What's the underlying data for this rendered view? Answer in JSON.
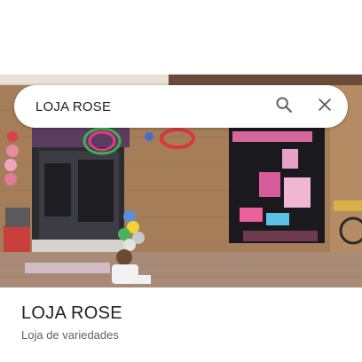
{
  "search": {
    "query": "LOJA ROSE",
    "search_icon": "search-icon",
    "close_icon": "close-icon"
  },
  "photo": {
    "kind": "street-view-storefront"
  },
  "place": {
    "name": "LOJA ROSE",
    "category": "Loja de variedades"
  },
  "colors": {
    "text_primary": "#202124",
    "text_secondary": "#5f6368",
    "icon": "#5f6368",
    "wall": "#a07a56",
    "floor": "#9a7a66"
  }
}
